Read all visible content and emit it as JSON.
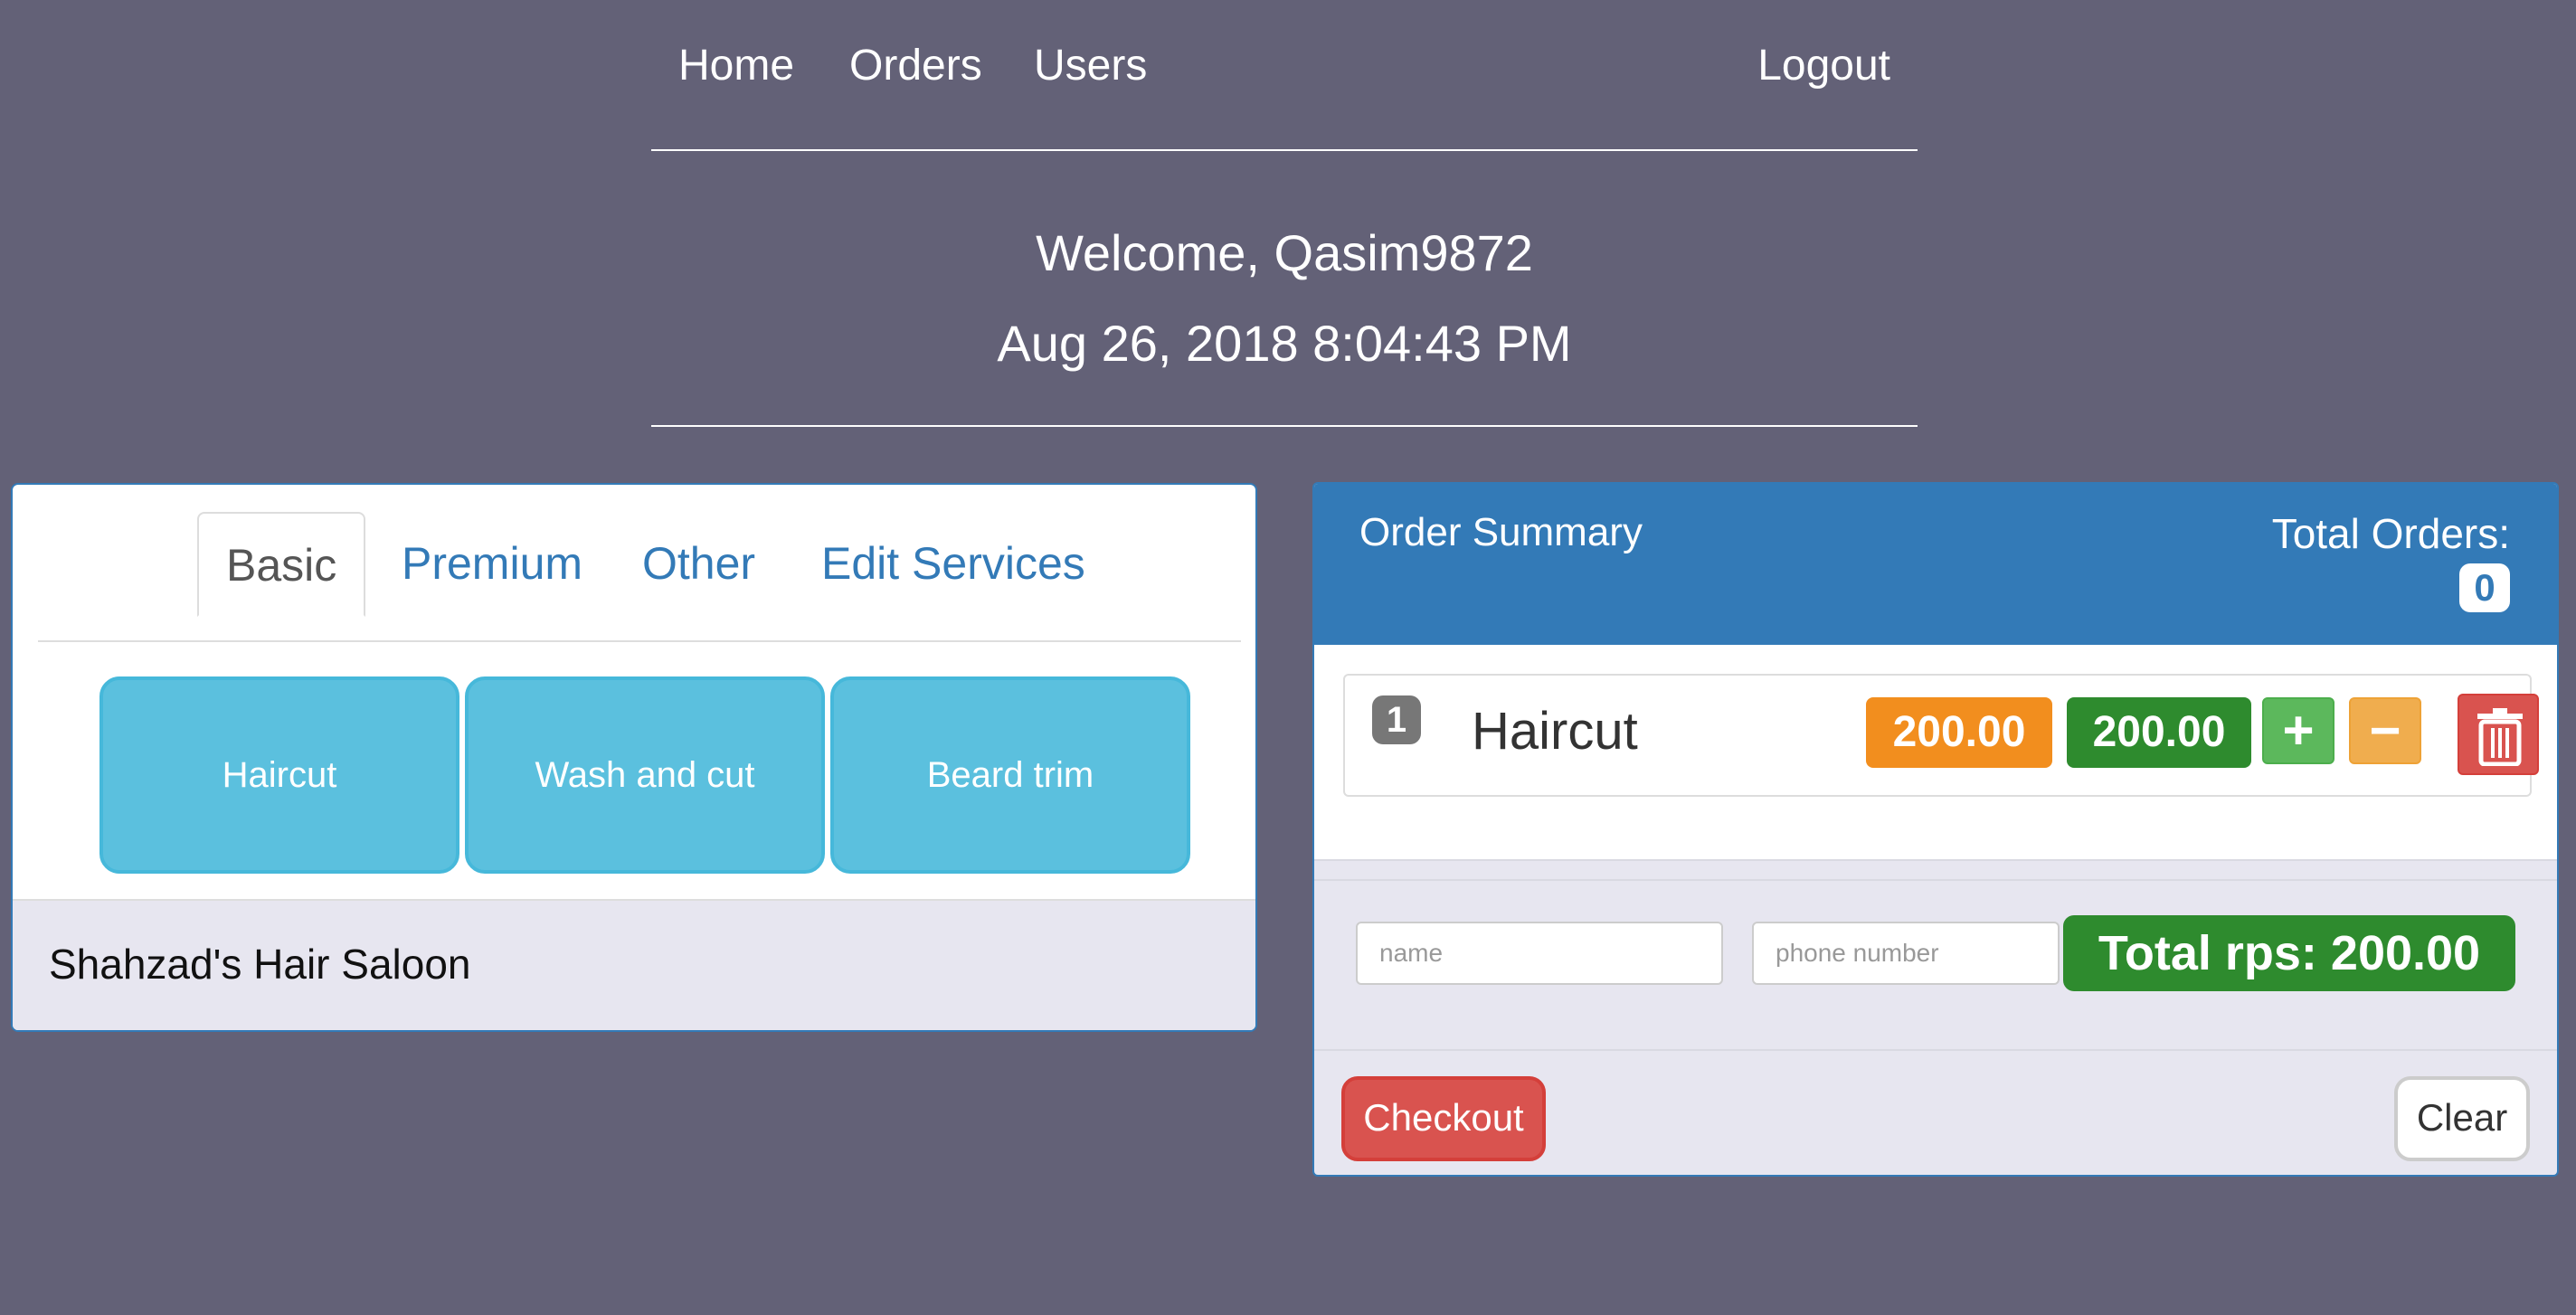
{
  "nav": {
    "home": "Home",
    "orders": "Orders",
    "users": "Users",
    "logout": "Logout"
  },
  "welcome": {
    "greeting": "Welcome, Qasim9872",
    "datetime": "Aug 26, 2018 8:04:43 PM"
  },
  "services_panel": {
    "tabs": [
      {
        "label": "Basic",
        "active": true
      },
      {
        "label": "Premium",
        "active": false
      },
      {
        "label": "Other",
        "active": false
      },
      {
        "label": "Edit Services",
        "active": false
      }
    ],
    "services": [
      "Haircut",
      "Wash and cut",
      "Beard trim"
    ],
    "footer": "Shahzad's Hair Saloon"
  },
  "order_summary": {
    "title": "Order Summary",
    "total_orders_label": "Total Orders:",
    "total_orders_count": "0",
    "items": [
      {
        "qty": "1",
        "name": "Haircut",
        "unit_price": "200.00",
        "line_total": "200.00"
      }
    ],
    "controls": {
      "plus": "+",
      "minus": "−",
      "delete_icon": "trash-icon"
    },
    "name_placeholder": "name",
    "phone_placeholder": "phone number",
    "total": "Total rps: 200.00",
    "checkout": "Checkout",
    "clear": "Clear"
  },
  "colors": {
    "background": "#636177",
    "primary": "#337ab7",
    "service_button": "#5bc0de",
    "unit_price": "#f28e1e",
    "line_total": "#2e8b2e",
    "plus": "#5cb85c",
    "minus": "#f0ad4e",
    "danger": "#d9534f"
  }
}
